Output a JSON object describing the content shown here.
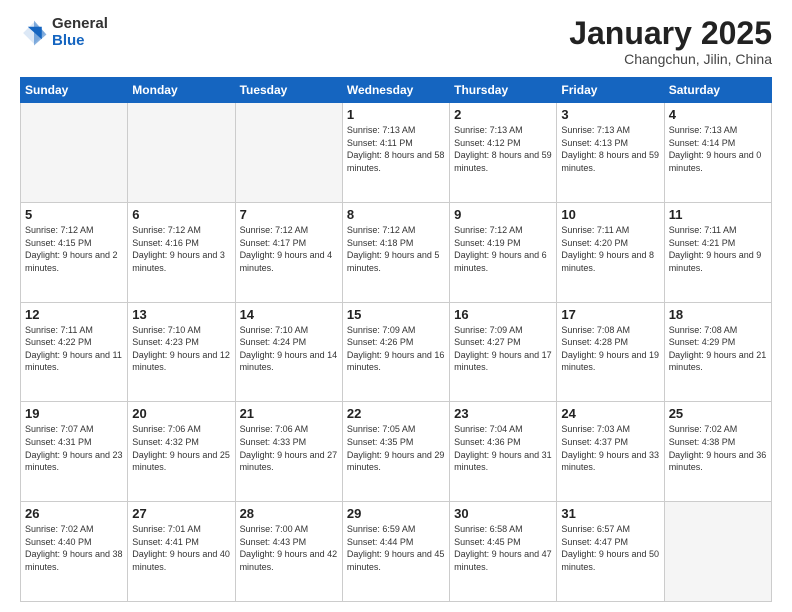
{
  "header": {
    "logo_general": "General",
    "logo_blue": "Blue",
    "month_title": "January 2025",
    "subtitle": "Changchun, Jilin, China"
  },
  "days_of_week": [
    "Sunday",
    "Monday",
    "Tuesday",
    "Wednesday",
    "Thursday",
    "Friday",
    "Saturday"
  ],
  "weeks": [
    [
      {
        "day": "",
        "empty": true
      },
      {
        "day": "",
        "empty": true
      },
      {
        "day": "",
        "empty": true
      },
      {
        "day": "1",
        "sunrise": "7:13 AM",
        "sunset": "4:11 PM",
        "daylight": "8 hours and 58 minutes."
      },
      {
        "day": "2",
        "sunrise": "7:13 AM",
        "sunset": "4:12 PM",
        "daylight": "8 hours and 59 minutes."
      },
      {
        "day": "3",
        "sunrise": "7:13 AM",
        "sunset": "4:13 PM",
        "daylight": "8 hours and 59 minutes."
      },
      {
        "day": "4",
        "sunrise": "7:13 AM",
        "sunset": "4:14 PM",
        "daylight": "9 hours and 0 minutes."
      }
    ],
    [
      {
        "day": "5",
        "sunrise": "7:12 AM",
        "sunset": "4:15 PM",
        "daylight": "9 hours and 2 minutes."
      },
      {
        "day": "6",
        "sunrise": "7:12 AM",
        "sunset": "4:16 PM",
        "daylight": "9 hours and 3 minutes."
      },
      {
        "day": "7",
        "sunrise": "7:12 AM",
        "sunset": "4:17 PM",
        "daylight": "9 hours and 4 minutes."
      },
      {
        "day": "8",
        "sunrise": "7:12 AM",
        "sunset": "4:18 PM",
        "daylight": "9 hours and 5 minutes."
      },
      {
        "day": "9",
        "sunrise": "7:12 AM",
        "sunset": "4:19 PM",
        "daylight": "9 hours and 6 minutes."
      },
      {
        "day": "10",
        "sunrise": "7:11 AM",
        "sunset": "4:20 PM",
        "daylight": "9 hours and 8 minutes."
      },
      {
        "day": "11",
        "sunrise": "7:11 AM",
        "sunset": "4:21 PM",
        "daylight": "9 hours and 9 minutes."
      }
    ],
    [
      {
        "day": "12",
        "sunrise": "7:11 AM",
        "sunset": "4:22 PM",
        "daylight": "9 hours and 11 minutes."
      },
      {
        "day": "13",
        "sunrise": "7:10 AM",
        "sunset": "4:23 PM",
        "daylight": "9 hours and 12 minutes."
      },
      {
        "day": "14",
        "sunrise": "7:10 AM",
        "sunset": "4:24 PM",
        "daylight": "9 hours and 14 minutes."
      },
      {
        "day": "15",
        "sunrise": "7:09 AM",
        "sunset": "4:26 PM",
        "daylight": "9 hours and 16 minutes."
      },
      {
        "day": "16",
        "sunrise": "7:09 AM",
        "sunset": "4:27 PM",
        "daylight": "9 hours and 17 minutes."
      },
      {
        "day": "17",
        "sunrise": "7:08 AM",
        "sunset": "4:28 PM",
        "daylight": "9 hours and 19 minutes."
      },
      {
        "day": "18",
        "sunrise": "7:08 AM",
        "sunset": "4:29 PM",
        "daylight": "9 hours and 21 minutes."
      }
    ],
    [
      {
        "day": "19",
        "sunrise": "7:07 AM",
        "sunset": "4:31 PM",
        "daylight": "9 hours and 23 minutes."
      },
      {
        "day": "20",
        "sunrise": "7:06 AM",
        "sunset": "4:32 PM",
        "daylight": "9 hours and 25 minutes."
      },
      {
        "day": "21",
        "sunrise": "7:06 AM",
        "sunset": "4:33 PM",
        "daylight": "9 hours and 27 minutes."
      },
      {
        "day": "22",
        "sunrise": "7:05 AM",
        "sunset": "4:35 PM",
        "daylight": "9 hours and 29 minutes."
      },
      {
        "day": "23",
        "sunrise": "7:04 AM",
        "sunset": "4:36 PM",
        "daylight": "9 hours and 31 minutes."
      },
      {
        "day": "24",
        "sunrise": "7:03 AM",
        "sunset": "4:37 PM",
        "daylight": "9 hours and 33 minutes."
      },
      {
        "day": "25",
        "sunrise": "7:02 AM",
        "sunset": "4:38 PM",
        "daylight": "9 hours and 36 minutes."
      }
    ],
    [
      {
        "day": "26",
        "sunrise": "7:02 AM",
        "sunset": "4:40 PM",
        "daylight": "9 hours and 38 minutes."
      },
      {
        "day": "27",
        "sunrise": "7:01 AM",
        "sunset": "4:41 PM",
        "daylight": "9 hours and 40 minutes."
      },
      {
        "day": "28",
        "sunrise": "7:00 AM",
        "sunset": "4:43 PM",
        "daylight": "9 hours and 42 minutes."
      },
      {
        "day": "29",
        "sunrise": "6:59 AM",
        "sunset": "4:44 PM",
        "daylight": "9 hours and 45 minutes."
      },
      {
        "day": "30",
        "sunrise": "6:58 AM",
        "sunset": "4:45 PM",
        "daylight": "9 hours and 47 minutes."
      },
      {
        "day": "31",
        "sunrise": "6:57 AM",
        "sunset": "4:47 PM",
        "daylight": "9 hours and 50 minutes."
      },
      {
        "day": "",
        "empty": true
      }
    ]
  ],
  "labels": {
    "sunrise_label": "Sunrise:",
    "sunset_label": "Sunset:",
    "daylight_label": "Daylight:"
  }
}
